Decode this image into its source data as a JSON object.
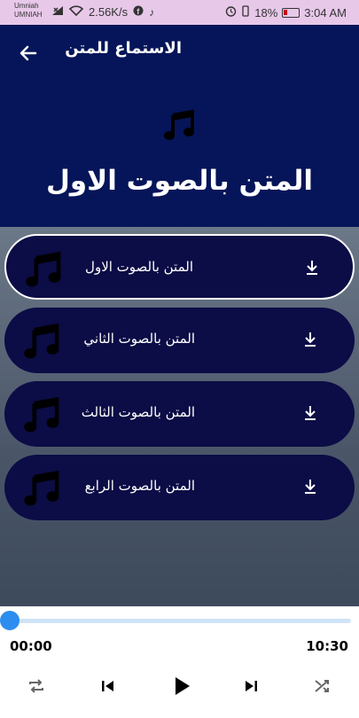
{
  "status_bar": {
    "carrier_1": "Umniah",
    "carrier_2": "UMNIAH",
    "net_speed": "2.56K/s",
    "battery": "18%",
    "time": "3:04 AM"
  },
  "header": {
    "title": "الاستماع للمتن",
    "now_playing": "المتن بالصوت الاول"
  },
  "tracks": [
    {
      "label": "المتن بالصوت الاول",
      "active": true
    },
    {
      "label": "المتن بالصوت الثاني",
      "active": false
    },
    {
      "label": "المتن بالصوت الثالث",
      "active": false
    },
    {
      "label": "المتن بالصوت الرابع",
      "active": false
    }
  ],
  "player": {
    "current_time": "00:00",
    "total_time": "10:30",
    "progress": 0
  },
  "colors": {
    "header_bg": "#061559",
    "item_bg": "#0c0c46",
    "accent": "#2d8cf0"
  }
}
